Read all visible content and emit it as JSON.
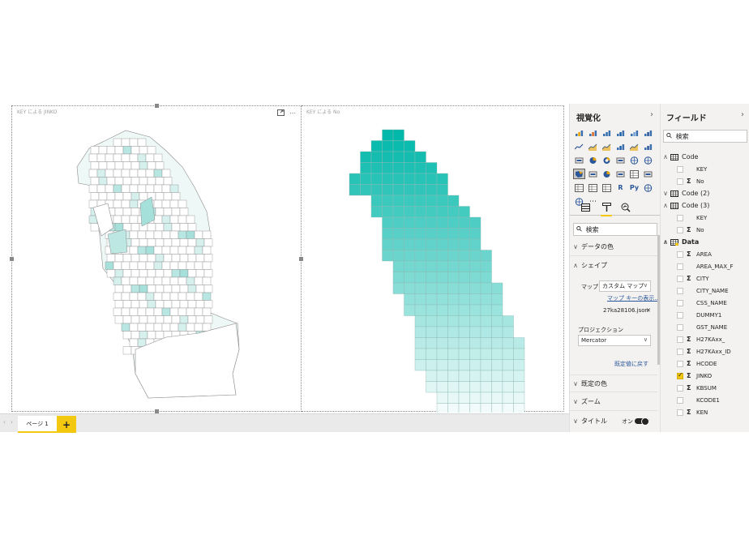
{
  "colors": {
    "accent": "#f2c811",
    "teal_dark": "#01b8aa",
    "teal_light": "#f2fbfa",
    "link": "#2b579a"
  },
  "canvas": {
    "left_visual": {
      "title": "KEY による JINKO",
      "icons": [
        "focus-mode-icon",
        "more-options-icon"
      ],
      "more": "⋯"
    },
    "right_visual": {
      "title": "KEY による No"
    }
  },
  "pagebar": {
    "prev": "‹",
    "next": "›",
    "tab_label": "ページ 1",
    "add_label": "+"
  },
  "viz_pane": {
    "title": "視覚化",
    "chevron": "›",
    "search_placeholder": "検索",
    "sections": {
      "data_color": "データの色",
      "shape": "シェイプ",
      "default_color": "既定の色",
      "zoom": "ズーム",
      "title": "タイトル"
    },
    "shape_props": {
      "map_label": "マップ",
      "map_value": "カスタム マップ",
      "map_key_link": "マップ キーの表示...",
      "file_name": "27ka28106.json",
      "file_remove": "✕",
      "projection_label": "プロジェクション",
      "projection_value": "Mercator",
      "reset_link": "既定値に戻す"
    },
    "title_toggle": "オン",
    "more_visuals": "⋯"
  },
  "fields_pane": {
    "title": "フィールド",
    "chevron": "›",
    "search_placeholder": "検索",
    "rows": [
      {
        "type": "table",
        "label": "Code",
        "expanded": true
      },
      {
        "type": "field",
        "label": "KEY",
        "sigma": false,
        "checked": false
      },
      {
        "type": "field",
        "label": "No",
        "sigma": true,
        "checked": false
      },
      {
        "type": "table",
        "label": "Code (2)",
        "expanded": false
      },
      {
        "type": "table",
        "label": "Code (3)",
        "expanded": true
      },
      {
        "type": "field",
        "label": "KEY",
        "sigma": false,
        "checked": false
      },
      {
        "type": "field",
        "label": "No",
        "sigma": true,
        "checked": false
      },
      {
        "type": "table",
        "label": "Data",
        "expanded": true,
        "bold": true,
        "has_check": true
      },
      {
        "type": "field",
        "label": "AREA",
        "sigma": true,
        "checked": false
      },
      {
        "type": "field",
        "label": "AREA_MAX_F",
        "sigma": false,
        "checked": false
      },
      {
        "type": "field",
        "label": "CITY",
        "sigma": true,
        "checked": false
      },
      {
        "type": "field",
        "label": "CITY_NAME",
        "sigma": false,
        "checked": false
      },
      {
        "type": "field",
        "label": "CSS_NAME",
        "sigma": false,
        "checked": false
      },
      {
        "type": "field",
        "label": "DUMMY1",
        "sigma": false,
        "checked": false
      },
      {
        "type": "field",
        "label": "GST_NAME",
        "sigma": false,
        "checked": false
      },
      {
        "type": "field",
        "label": "H27KAxx_",
        "sigma": true,
        "checked": false
      },
      {
        "type": "field",
        "label": "H27KAxx_ID",
        "sigma": true,
        "checked": false
      },
      {
        "type": "field",
        "label": "HCODE",
        "sigma": true,
        "checked": false
      },
      {
        "type": "field",
        "label": "JINKO",
        "sigma": true,
        "checked": true
      },
      {
        "type": "field",
        "label": "KBSUM",
        "sigma": true,
        "checked": false
      },
      {
        "type": "field",
        "label": "KCODE1",
        "sigma": false,
        "checked": false
      },
      {
        "type": "field",
        "label": "KEN",
        "sigma": true,
        "checked": false
      }
    ]
  }
}
